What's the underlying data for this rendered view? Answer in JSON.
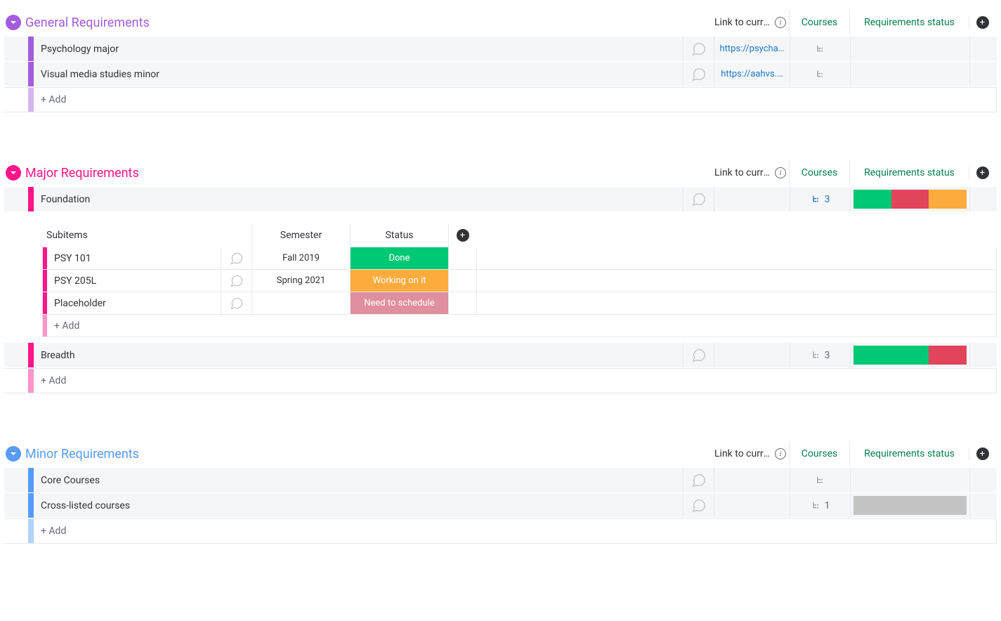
{
  "ui": {
    "add_label": "+ Add",
    "columns": {
      "link": "Link to curri…",
      "courses": "Courses",
      "req_status": "Requirements status"
    },
    "sub_columns": {
      "subitems": "Subitems",
      "semester": "Semester",
      "status": "Status"
    }
  },
  "colors": {
    "green": "#00c875",
    "orange": "#fdab3d",
    "red": "#e2445c",
    "red_soft": "#df8f9d",
    "grey": "#c4c4c4",
    "blue_link": "#1f76c2"
  },
  "groups": [
    {
      "id": "general",
      "title": "General Requirements",
      "color": "#a25ddc",
      "rows": [
        {
          "name": "Psychology major",
          "link": "https://psycha…",
          "courses_count": null,
          "courses_active": false,
          "status_segments": []
        },
        {
          "name": "Visual media studies minor",
          "link": "https://aahvs.…",
          "courses_count": null,
          "courses_active": false,
          "status_segments": []
        }
      ]
    },
    {
      "id": "major",
      "title": "Major Requirements",
      "color": "#ff158a",
      "rows": [
        {
          "name": "Foundation",
          "link": "",
          "courses_count": 3,
          "courses_active": true,
          "status_segments": [
            {
              "color": "#00c875",
              "weight": 1
            },
            {
              "color": "#e2445c",
              "weight": 1
            },
            {
              "color": "#fdab3d",
              "weight": 1
            }
          ],
          "subitems": [
            {
              "name": "PSY 101",
              "semester": "Fall 2019",
              "status_label": "Done",
              "status_color": "#00c875"
            },
            {
              "name": "PSY 205L",
              "semester": "Spring 2021",
              "status_label": "Working on it",
              "status_color": "#fdab3d"
            },
            {
              "name": "Placeholder",
              "semester": "",
              "status_label": "Need to schedule",
              "status_color": "#df8f9d"
            }
          ]
        },
        {
          "name": "Breadth",
          "link": "",
          "courses_count": 3,
          "courses_active": false,
          "status_segments": [
            {
              "color": "#00c875",
              "weight": 2
            },
            {
              "color": "#e2445c",
              "weight": 1
            }
          ]
        }
      ]
    },
    {
      "id": "minor",
      "title": "Minor Requirements",
      "color": "#579bfc",
      "rows": [
        {
          "name": "Core Courses",
          "link": "",
          "courses_count": null,
          "courses_active": false,
          "status_segments": []
        },
        {
          "name": "Cross-listed courses",
          "link": "",
          "courses_count": 1,
          "courses_active": false,
          "status_segments": [
            {
              "color": "#c4c4c4",
              "weight": 1
            }
          ]
        }
      ]
    }
  ]
}
